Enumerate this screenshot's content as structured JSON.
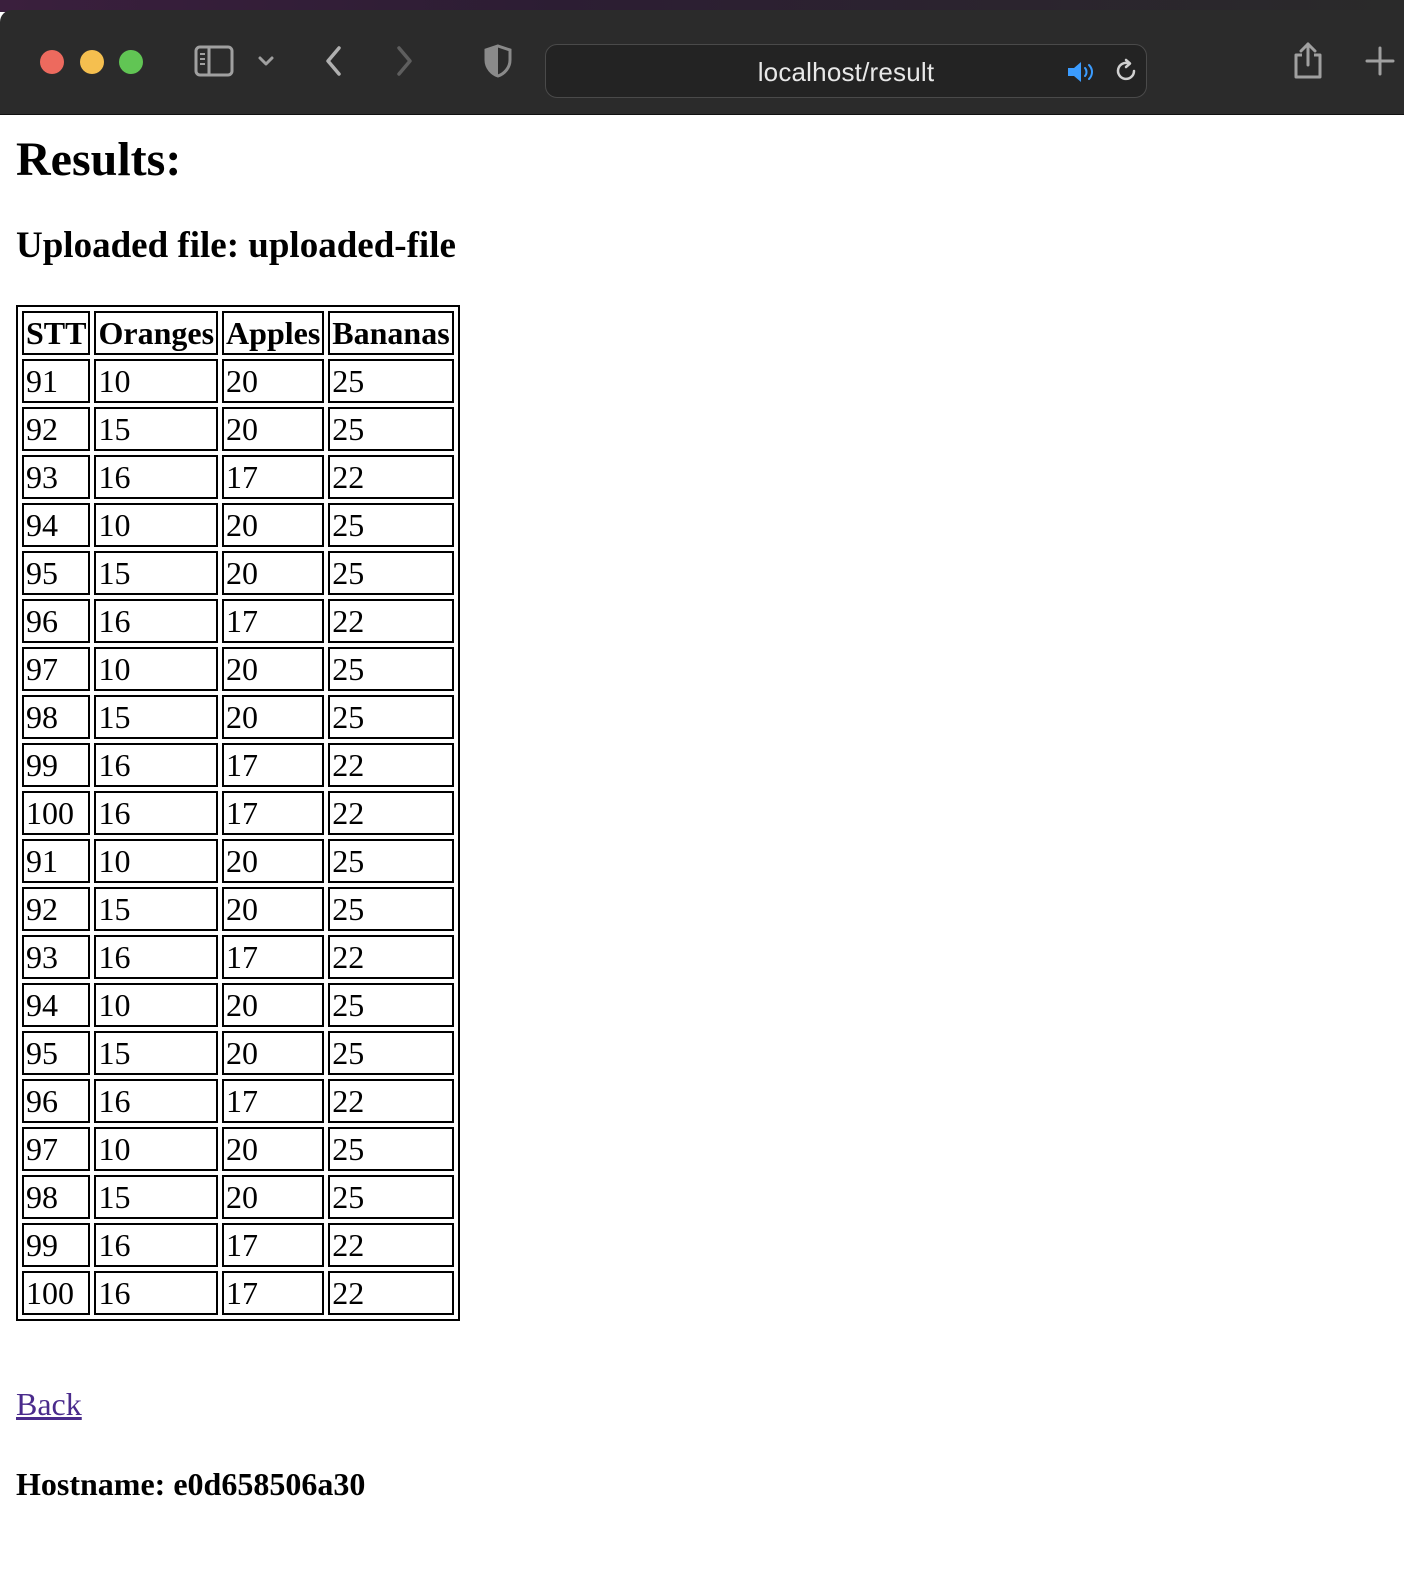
{
  "browser": {
    "url": "localhost/result",
    "accent_color": "#3b9cff"
  },
  "page": {
    "title": "Results:",
    "uploaded_prefix": "Uploaded file: ",
    "uploaded_name": "uploaded-file",
    "table": {
      "headers": [
        "STT",
        "Oranges",
        "Apples",
        "Bananas"
      ],
      "rows": [
        [
          "91",
          "10",
          "20",
          "25"
        ],
        [
          "92",
          "15",
          "20",
          "25"
        ],
        [
          "93",
          "16",
          "17",
          "22"
        ],
        [
          "94",
          "10",
          "20",
          "25"
        ],
        [
          "95",
          "15",
          "20",
          "25"
        ],
        [
          "96",
          "16",
          "17",
          "22"
        ],
        [
          "97",
          "10",
          "20",
          "25"
        ],
        [
          "98",
          "15",
          "20",
          "25"
        ],
        [
          "99",
          "16",
          "17",
          "22"
        ],
        [
          "100",
          "16",
          "17",
          "22"
        ],
        [
          "91",
          "10",
          "20",
          "25"
        ],
        [
          "92",
          "15",
          "20",
          "25"
        ],
        [
          "93",
          "16",
          "17",
          "22"
        ],
        [
          "94",
          "10",
          "20",
          "25"
        ],
        [
          "95",
          "15",
          "20",
          "25"
        ],
        [
          "96",
          "16",
          "17",
          "22"
        ],
        [
          "97",
          "10",
          "20",
          "25"
        ],
        [
          "98",
          "15",
          "20",
          "25"
        ],
        [
          "99",
          "16",
          "17",
          "22"
        ],
        [
          "100",
          "16",
          "17",
          "22"
        ]
      ]
    },
    "back_label": "Back",
    "hostname_prefix": "Hostname: ",
    "hostname_value": "e0d658506a30"
  }
}
